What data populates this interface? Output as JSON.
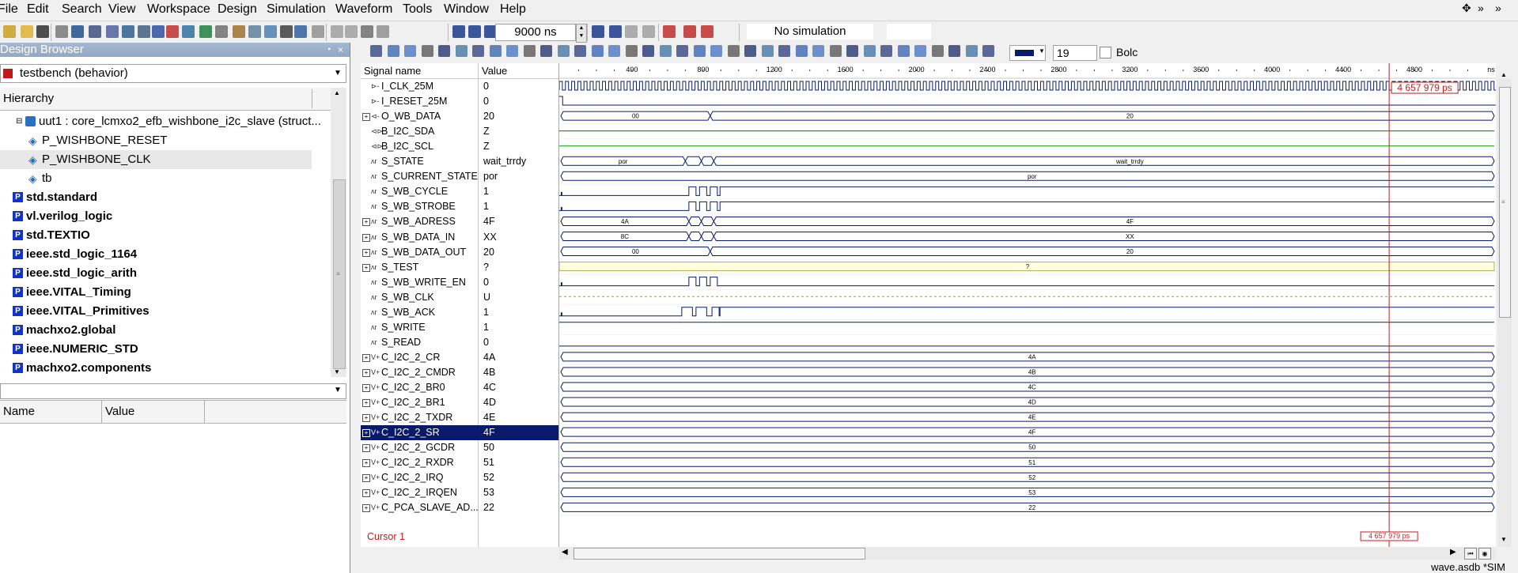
{
  "menu": [
    "File",
    "Edit",
    "Search",
    "View",
    "Workspace",
    "Design",
    "Simulation",
    "Waveform",
    "Tools",
    "Window",
    "Help"
  ],
  "toolbar": {
    "sim_time": "9000 ns",
    "sim_status": "No simulation"
  },
  "design_browser": {
    "title": "Design Browser",
    "top_selector": "testbench (behavior)",
    "hierarchy_header": "Hierarchy",
    "tree": [
      {
        "label": "uut1 : core_lcmxo2_efb_wishbone_i2c_slave (struct...",
        "icon": "component-icon",
        "indent": 1,
        "bold": false
      },
      {
        "label": "P_WISHBONE_RESET",
        "icon": "process-icon",
        "indent": 2,
        "bold": false
      },
      {
        "label": "P_WISHBONE_CLK",
        "icon": "process-icon",
        "indent": 2,
        "bold": false
      },
      {
        "label": "tb",
        "icon": "process-icon",
        "indent": 2,
        "bold": false
      },
      {
        "label": "std.standard",
        "icon": "package-icon",
        "indent": 0,
        "bold": true
      },
      {
        "label": "vl.verilog_logic",
        "icon": "package-icon",
        "indent": 0,
        "bold": true
      },
      {
        "label": "std.TEXTIO",
        "icon": "package-icon",
        "indent": 0,
        "bold": true
      },
      {
        "label": "ieee.std_logic_1164",
        "icon": "package-icon",
        "indent": 0,
        "bold": true
      },
      {
        "label": "ieee.std_logic_arith",
        "icon": "package-icon",
        "indent": 0,
        "bold": true
      },
      {
        "label": "ieee.VITAL_Timing",
        "icon": "package-icon",
        "indent": 0,
        "bold": true
      },
      {
        "label": "ieee.VITAL_Primitives",
        "icon": "package-icon",
        "indent": 0,
        "bold": true
      },
      {
        "label": "machxo2.global",
        "icon": "package-icon",
        "indent": 0,
        "bold": true
      },
      {
        "label": "ieee.NUMERIC_STD",
        "icon": "package-icon",
        "indent": 0,
        "bold": true
      },
      {
        "label": "machxo2.components",
        "icon": "package-icon",
        "indent": 0,
        "bold": true
      }
    ],
    "name_header": "Name",
    "value_header": "Value"
  },
  "wave_toolbar": {
    "font_size": "19",
    "bold_label": "Bolc"
  },
  "signals_header": {
    "name": "Signal name",
    "value": "Value"
  },
  "signals": [
    {
      "name": "I_CLK_25M",
      "value": "0",
      "type": "in",
      "expand": false,
      "wave": "clock"
    },
    {
      "name": "I_RESET_25M",
      "value": "0",
      "type": "in",
      "expand": false,
      "wave": "reset"
    },
    {
      "name": "O_WB_DATA",
      "value": "20",
      "type": "out",
      "expand": true,
      "wave": "bus",
      "labels": [
        "00",
        "20"
      ]
    },
    {
      "name": "B_I2C_SDA",
      "value": "Z",
      "type": "inout",
      "expand": false,
      "wave": "z"
    },
    {
      "name": "B_I2C_SCL",
      "value": "Z",
      "type": "inout",
      "expand": false,
      "wave": "z"
    },
    {
      "name": "S_STATE",
      "value": "wait_trrdy",
      "type": "sig",
      "expand": false,
      "wave": "bus",
      "labels": [
        "por",
        "wait_trrdy"
      ]
    },
    {
      "name": "S_CURRENT_STATE",
      "value": "por",
      "type": "sig",
      "expand": false,
      "wave": "bus",
      "labels": [
        "por"
      ]
    },
    {
      "name": "S_WB_CYCLE",
      "value": "1",
      "type": "sig",
      "expand": false,
      "wave": "pulse"
    },
    {
      "name": "S_WB_STROBE",
      "value": "1",
      "type": "sig",
      "expand": false,
      "wave": "pulse"
    },
    {
      "name": "S_WB_ADRESS",
      "value": "4F",
      "type": "sig",
      "expand": true,
      "wave": "bus",
      "labels": [
        "4A",
        "4F"
      ]
    },
    {
      "name": "S_WB_DATA_IN",
      "value": "XX",
      "type": "sig",
      "expand": true,
      "wave": "bus",
      "labels": [
        "8C",
        "XX"
      ]
    },
    {
      "name": "S_WB_DATA_OUT",
      "value": "20",
      "type": "sig",
      "expand": true,
      "wave": "bus",
      "labels": [
        "00",
        "20"
      ]
    },
    {
      "name": "S_TEST",
      "value": "?",
      "type": "sig",
      "expand": true,
      "wave": "unknown",
      "labels": [
        "?"
      ]
    },
    {
      "name": "S_WB_WRITE_EN",
      "value": "0",
      "type": "sig",
      "expand": false,
      "wave": "pulse"
    },
    {
      "name": "S_WB_CLK",
      "value": "U",
      "type": "sig",
      "expand": false,
      "wave": "undefined"
    },
    {
      "name": "S_WB_ACK",
      "value": "1",
      "type": "sig",
      "expand": false,
      "wave": "ack"
    },
    {
      "name": "S_WRITE",
      "value": "1",
      "type": "sig",
      "expand": false,
      "wave": "high"
    },
    {
      "name": "S_READ",
      "value": "0",
      "type": "sig",
      "expand": false,
      "wave": "low"
    },
    {
      "name": "C_I2C_2_CR",
      "value": "4A",
      "type": "const",
      "expand": true,
      "wave": "bus",
      "labels": [
        "4A"
      ]
    },
    {
      "name": "C_I2C_2_CMDR",
      "value": "4B",
      "type": "const",
      "expand": true,
      "wave": "bus",
      "labels": [
        "4B"
      ]
    },
    {
      "name": "C_I2C_2_BR0",
      "value": "4C",
      "type": "const",
      "expand": true,
      "wave": "bus",
      "labels": [
        "4C"
      ]
    },
    {
      "name": "C_I2C_2_BR1",
      "value": "4D",
      "type": "const",
      "expand": true,
      "wave": "bus",
      "labels": [
        "4D"
      ]
    },
    {
      "name": "C_I2C_2_TXDR",
      "value": "4E",
      "type": "const",
      "expand": true,
      "wave": "bus",
      "labels": [
        "4E"
      ]
    },
    {
      "name": "C_I2C_2_SR",
      "value": "4F",
      "type": "const",
      "expand": true,
      "wave": "bus",
      "labels": [
        "4F"
      ],
      "selected": true
    },
    {
      "name": "C_I2C_2_GCDR",
      "value": "50",
      "type": "const",
      "expand": true,
      "wave": "bus",
      "labels": [
        "50"
      ]
    },
    {
      "name": "C_I2C_2_RXDR",
      "value": "51",
      "type": "const",
      "expand": true,
      "wave": "bus",
      "labels": [
        "51"
      ]
    },
    {
      "name": "C_I2C_2_IRQ",
      "value": "52",
      "type": "const",
      "expand": true,
      "wave": "bus",
      "labels": [
        "52"
      ]
    },
    {
      "name": "C_I2C_2_IRQEN",
      "value": "53",
      "type": "const",
      "expand": true,
      "wave": "bus",
      "labels": [
        "53"
      ]
    },
    {
      "name": "C_PCA_SLAVE_AD...",
      "value": "22",
      "type": "const",
      "expand": true,
      "wave": "bus",
      "labels": [
        "22"
      ]
    }
  ],
  "timeline": {
    "ticks": [
      "400",
      "800",
      "1200",
      "1600",
      "2000",
      "2400",
      "2800",
      "3200",
      "3600",
      "4000",
      "4400",
      "4800"
    ],
    "unit": "ns"
  },
  "cursor": {
    "label": "Cursor 1",
    "time": "4 657 979 ps",
    "time_ns": 4658
  },
  "status": {
    "file": "wave.asdb *SIM"
  },
  "colors": {
    "selection": "#0a1a6a",
    "cursor": "#c02020",
    "wave": "#0a1a6a",
    "z_line": "#20a020"
  }
}
